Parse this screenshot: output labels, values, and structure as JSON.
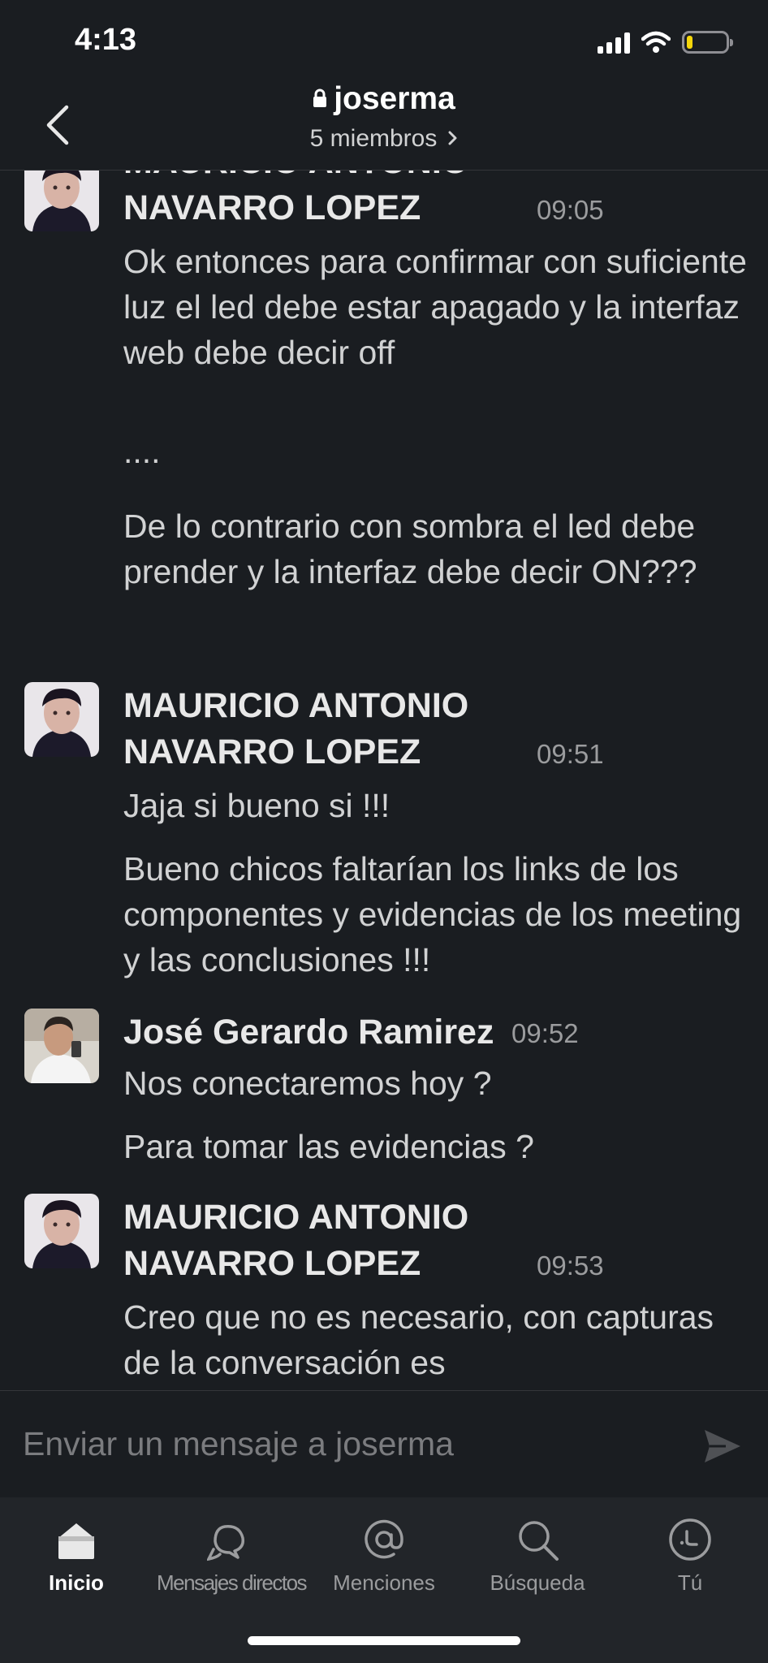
{
  "status_bar": {
    "time": "4:13",
    "battery_level": 0.15
  },
  "header": {
    "channel_name": "joserma",
    "members_label": "5 miembros"
  },
  "messages": [
    {
      "author": "MAURICIO ANTONIO NAVARRO LOPEZ",
      "author_line1": "MAURICIO ANTONIO",
      "author_line2": "NAVARRO LOPEZ",
      "time": "09:05",
      "avatar": "avatar-mauricio",
      "paragraphs": [
        "Ok entonces para confirmar con suficiente luz el led debe estar apagado y la interfaz web debe decir off",
        "....",
        "De lo contrario con sombra el led debe prender y la interfaz debe decir ON???"
      ]
    },
    {
      "author": "MAURICIO ANTONIO NAVARRO LOPEZ",
      "author_line1": "MAURICIO ANTONIO",
      "author_line2": "NAVARRO LOPEZ",
      "time": "09:51",
      "avatar": "avatar-mauricio",
      "paragraphs": [
        "Jaja si bueno si !!!",
        "Bueno chicos faltarían los links de los componentes y evidencias de los meeting y las conclusiones !!!"
      ]
    },
    {
      "author": "José Gerardo Ramirez",
      "time": "09:52",
      "avatar": "avatar-jose",
      "paragraphs": [
        "Nos conectaremos hoy ?",
        "Para tomar las evidencias ?"
      ]
    },
    {
      "author": "MAURICIO ANTONIO NAVARRO LOPEZ",
      "author_line1": "MAURICIO ANTONIO",
      "author_line2": "NAVARRO LOPEZ",
      "time": "09:53",
      "avatar": "avatar-mauricio",
      "paragraphs": [
        "Creo que no es necesario, con capturas de la conversación es"
      ]
    }
  ],
  "composer": {
    "placeholder": "Enviar un mensaje a joserma"
  },
  "tabbar": {
    "tabs": [
      {
        "label": "Inicio",
        "icon": "home-icon",
        "active": true
      },
      {
        "label": "Mensajes directos",
        "icon": "direct-messages-icon",
        "active": false
      },
      {
        "label": "Menciones",
        "icon": "at-icon",
        "active": false
      },
      {
        "label": "Búsqueda",
        "icon": "search-icon",
        "active": false
      },
      {
        "label": "Tú",
        "icon": "profile-icon",
        "active": false
      }
    ]
  },
  "colors": {
    "background": "#1a1d21",
    "tabbar": "#222529",
    "text": "#d1d2d3",
    "muted": "#9b9c9e",
    "battery": "#f5d60a"
  }
}
